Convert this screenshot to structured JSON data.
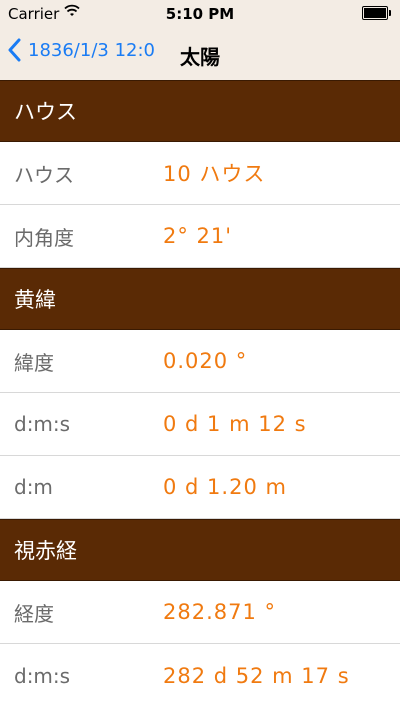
{
  "status": {
    "carrier": "Carrier",
    "time": "5:10 PM"
  },
  "nav": {
    "back_label": "1836/1/3 12:0",
    "title": "太陽"
  },
  "sections": [
    {
      "header": "ハウス",
      "rows": [
        {
          "label": "ハウス",
          "value": "10 ハウス"
        },
        {
          "label": "内角度",
          "value": "2° 21'"
        }
      ]
    },
    {
      "header": "黄緯",
      "rows": [
        {
          "label": "緯度",
          "value": "0.020 °"
        },
        {
          "label": "d:m:s",
          "value": "0 d 1 m 12 s"
        },
        {
          "label": "d:m",
          "value": "0 d 1.20 m"
        }
      ]
    },
    {
      "header": "視赤経",
      "rows": [
        {
          "label": "経度",
          "value": "282.871 °"
        },
        {
          "label": "d:m:s",
          "value": "282 d 52 m 17 s"
        }
      ]
    }
  ],
  "colors": {
    "header_bg": "#5a2a05",
    "value_text": "#f07a10",
    "back_tint": "#1a7cf4"
  }
}
